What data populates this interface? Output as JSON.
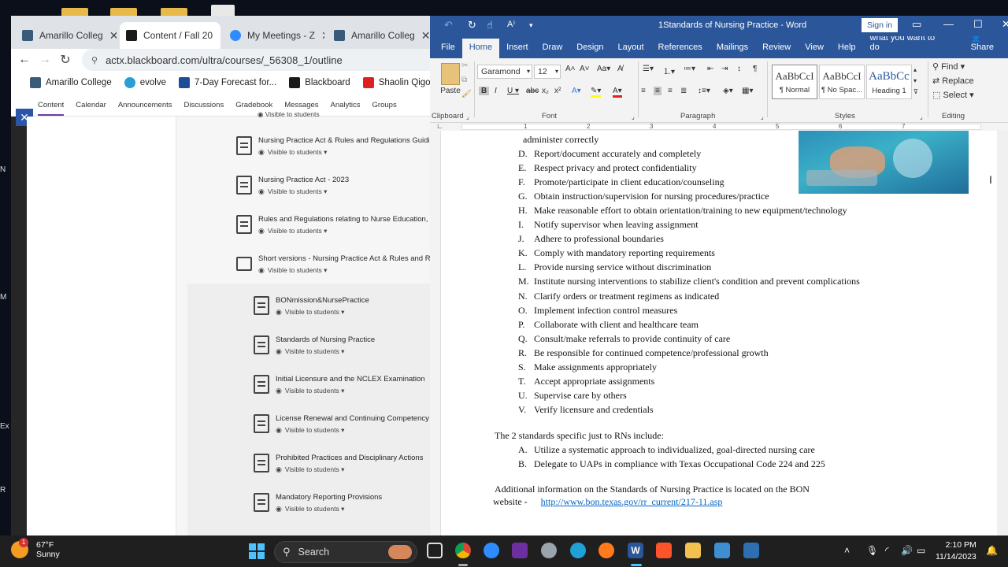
{
  "desktop": {
    "side_labels": [
      "N",
      "M",
      "Ex",
      "R"
    ]
  },
  "chrome": {
    "tabs": [
      {
        "label": "Amarillo Colleg",
        "icon": "amarillo-college-icon"
      },
      {
        "label": "Content / Fall 20",
        "icon": "blackboard-icon"
      },
      {
        "label": "My Meetings - Z",
        "icon": "zoom-icon"
      },
      {
        "label": "Amarillo Colleg",
        "icon": "amarillo-college-icon"
      }
    ],
    "url": "actx.blackboard.com/ultra/courses/_56308_1/outline",
    "bookmarks": [
      {
        "label": "Amarillo College",
        "color": "#3a5a7a"
      },
      {
        "label": "evolve",
        "color": "#2a9fd6"
      },
      {
        "label": "7-Day Forecast for...",
        "color": "#1b4d99"
      },
      {
        "label": "Blackboard",
        "color": "#1a1a1a"
      },
      {
        "label": "Shaolin Qigong - Y...",
        "color": "#e02020"
      }
    ],
    "course_nav": [
      "Content",
      "Calendar",
      "Announcements",
      "Discussions",
      "Gradebook",
      "Messages",
      "Analytics",
      "Groups"
    ],
    "partial_visibility": "Visible to students",
    "items": [
      {
        "title": "Nursing Practice Act & Rules and Regulations Guidi",
        "visibility": "Visible to students"
      },
      {
        "title": "Nursing Practice Act - 2023",
        "visibility": "Visible to students"
      },
      {
        "title": "Rules and Regulations relating to Nurse Education,",
        "visibility": "Visible to students"
      },
      {
        "title": "Short versions - Nursing Practice Act & Rules and Re",
        "visibility": "Visible to students"
      }
    ],
    "sub_items": [
      {
        "title": "BONmission&NursePractice",
        "visibility": "Visible to students"
      },
      {
        "title": "Standards of Nursing Practice",
        "visibility": "Visible to students"
      },
      {
        "title": "Initial Licensure and the NCLEX Examination",
        "visibility": "Visible to students"
      },
      {
        "title": "License Renewal and Continuing Competency",
        "visibility": "Visible to students"
      },
      {
        "title": "Prohibited Practices and Disciplinary Actions",
        "visibility": "Visible to students"
      },
      {
        "title": "Mandatory Reporting Provisions",
        "visibility": "Visible to students"
      }
    ]
  },
  "word": {
    "title": "1Standards of Nursing Practice  -  Word",
    "sign_in": "Sign in",
    "menu": [
      "File",
      "Home",
      "Insert",
      "Draw",
      "Design",
      "Layout",
      "References",
      "Mailings",
      "Review",
      "View",
      "Help",
      "Tell me what you want to do",
      "Share"
    ],
    "font_name": "Garamond",
    "font_size": "12",
    "paste_label": "Paste",
    "groups": [
      "Clipboard",
      "Font",
      "Paragraph",
      "Styles",
      "Editing"
    ],
    "styles": [
      {
        "sample": "AaBbCcI",
        "name": "¶ Normal"
      },
      {
        "sample": "AaBbCcI",
        "name": "¶ No Spac..."
      },
      {
        "sample": "AaBbCc",
        "name": "Heading 1"
      }
    ],
    "editing": [
      "Find",
      "Replace",
      "Select"
    ],
    "ruler_numbers": [
      "1",
      "2",
      "3",
      "4",
      "5",
      "6",
      "7"
    ],
    "doc": {
      "top_fragment": "administer correctly",
      "list1": [
        {
          "k": "D.",
          "t": "Report/document accurately and completely"
        },
        {
          "k": "E.",
          "t": "Respect privacy and protect confidentiality"
        },
        {
          "k": "F.",
          "t": "Promote/participate in client education/counseling"
        },
        {
          "k": "G.",
          "t": "Obtain instruction/supervision for nursing procedures/practice"
        },
        {
          "k": "H.",
          "t": "Make reasonable effort to obtain orientation/training to new equipment/technology"
        },
        {
          "k": "I.",
          "t": "Notify supervisor when leaving assignment"
        },
        {
          "k": "J.",
          "t": "Adhere to professional boundaries"
        },
        {
          "k": "K.",
          "t": "Comply with mandatory reporting requirements"
        },
        {
          "k": "L.",
          "t": "Provide nursing service without discrimination"
        },
        {
          "k": "M.",
          "t": "Institute nursing interventions to stabilize client's condition and prevent complications"
        },
        {
          "k": "N.",
          "t": "Clarify orders or treatment regimens as indicated"
        },
        {
          "k": "O.",
          "t": "Implement infection control measures"
        },
        {
          "k": "P.",
          "t": "Collaborate with client and healthcare team"
        },
        {
          "k": "Q.",
          "t": "Consult/make referrals to provide continuity of care"
        },
        {
          "k": "R.",
          "t": "Be responsible for continued competence/professional growth"
        },
        {
          "k": "S.",
          "t": "Make assignments appropriately"
        },
        {
          "k": "T.",
          "t": "Accept appropriate assignments"
        },
        {
          "k": "U.",
          "t": "Supervise care by others"
        },
        {
          "k": "V.",
          "t": "Verify licensure and credentials"
        }
      ],
      "rn_heading": "The 2 standards specific just to RNs include:",
      "list2": [
        {
          "k": "A.",
          "t": "Utilize a systematic approach to individualized, goal-directed nursing care"
        },
        {
          "k": "B.",
          "t": "Delegate to UAPs in compliance with Texas Occupational Code 224 and 225"
        }
      ],
      "additional_line1": "Additional information on the Standards of Nursing Practice is located on the BON",
      "additional_line2": "website -",
      "link": "http://www.bon.texas.gov/rr_current/217-11.asp"
    }
  },
  "taskbar": {
    "temperature": "67°F",
    "condition": "Sunny",
    "weather_badge": "1",
    "search_label": "Search",
    "time": "2:10 PM",
    "date": "11/14/2023"
  }
}
